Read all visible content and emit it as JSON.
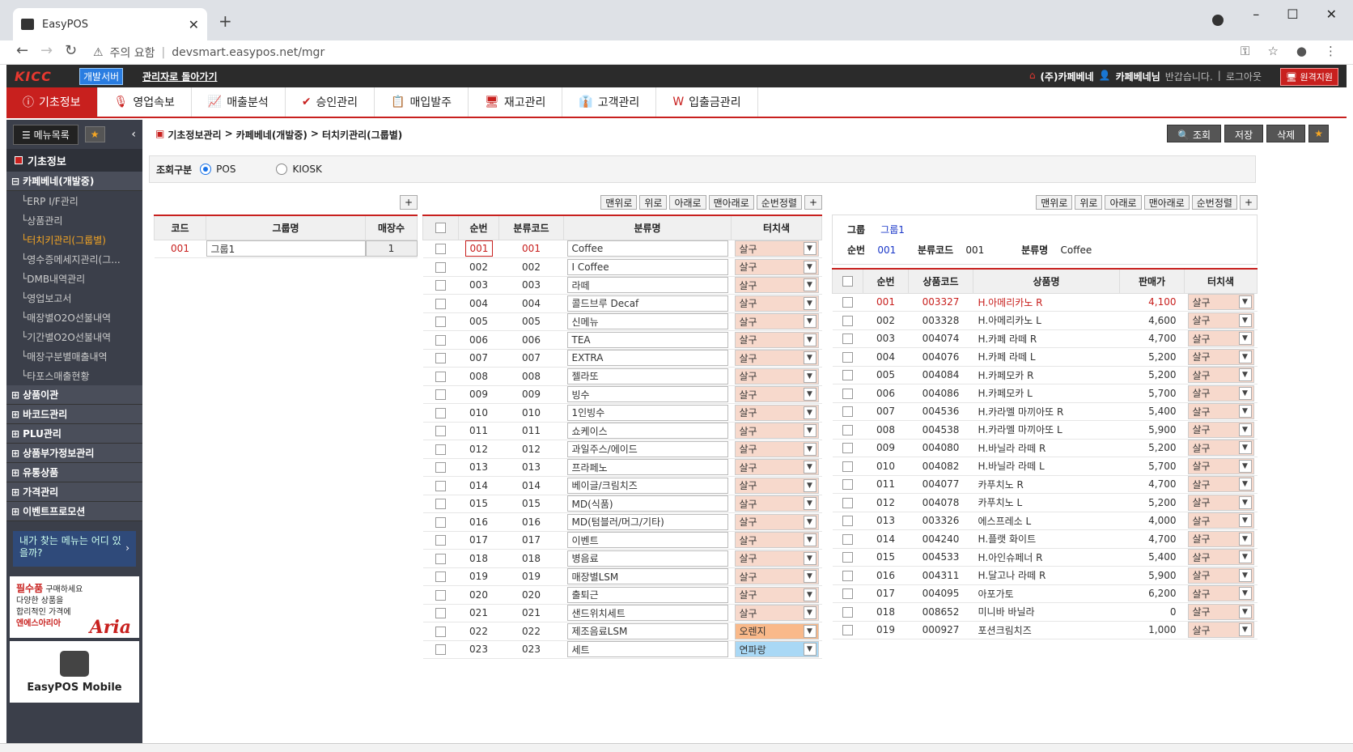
{
  "browser": {
    "tab_title": "EasyPOS",
    "warn": "주의 요함",
    "url": "devsmart.easypos.net/mgr"
  },
  "topbar": {
    "logo": "KICC",
    "dev": "개발서버",
    "back": "관리자로 돌아가기",
    "company": "(주)카페베네",
    "user": "카페베네님",
    "greet": "반갑습니다.",
    "logout": "로그아웃",
    "remote": "원격지원"
  },
  "menu": [
    {
      "label": "기초정보",
      "icon": "ⓘ",
      "active": true
    },
    {
      "label": "영업속보",
      "icon": "🎙"
    },
    {
      "label": "매출분석",
      "icon": "📈"
    },
    {
      "label": "승인관리",
      "icon": "✔"
    },
    {
      "label": "매입발주",
      "icon": "📋"
    },
    {
      "label": "재고관리",
      "icon": "🖥"
    },
    {
      "label": "고객관리",
      "icon": "👔"
    },
    {
      "label": "입출금관리",
      "icon": "W"
    }
  ],
  "sidebar": {
    "menu_btn": "메뉴목록",
    "header": "기초정보",
    "current_group": "카페베네(개발중)",
    "subs": [
      "ERP I/F관리",
      "상품관리",
      "터치키관리(그룹별)",
      "영수증메세지관리(그...",
      "DMB내역관리",
      "영업보고서",
      "매장별O2O선불내역",
      "기간별O2O선불내역",
      "매장구분별매출내역",
      "타포스매출현황"
    ],
    "groups": [
      "상품이관",
      "바코드관리",
      "PLU관리",
      "상품부가정보관리",
      "유통상품",
      "가격관리",
      "이벤트프로모션"
    ],
    "help": "내가 찾는 메뉴는 어디 있을까?",
    "ad_title": "필수품",
    "ad_rest": "구매하세요",
    "ad_l2": "다양한 상품을",
    "ad_l3": "합리적인 가격에",
    "ad_l4": "엔에스아리아",
    "ad_brand": "Aria",
    "mobile": "EasyPOS Mobile"
  },
  "breadcrumb": [
    "기초정보관리",
    "카페베네(개발중)",
    "터치키관리(그룹별)"
  ],
  "buttons": {
    "search": "조회",
    "save": "저장",
    "delete": "삭제",
    "top": "맨위로",
    "up": "위로",
    "down": "아래로",
    "bottom": "맨아래로",
    "sort": "순번정렬",
    "add": "+"
  },
  "filter": {
    "label": "조회구분",
    "opt1": "POS",
    "opt2": "KIOSK"
  },
  "group_table": {
    "headers": [
      "코드",
      "그룹명",
      "매장수"
    ],
    "rows": [
      {
        "code": "001",
        "name": "그룹1",
        "cnt": "1"
      }
    ]
  },
  "cat_table": {
    "headers": [
      "순번",
      "분류코드",
      "분류명",
      "터치색"
    ],
    "rows": [
      [
        "001",
        "001",
        "Coffee",
        "살구"
      ],
      [
        "002",
        "002",
        "I Coffee",
        "살구"
      ],
      [
        "003",
        "003",
        "라떼",
        "살구"
      ],
      [
        "004",
        "004",
        "콜드브루 Decaf",
        "살구"
      ],
      [
        "005",
        "005",
        "신메뉴",
        "살구"
      ],
      [
        "006",
        "006",
        "TEA",
        "살구"
      ],
      [
        "007",
        "007",
        "EXTRA",
        "살구"
      ],
      [
        "008",
        "008",
        "젤라또",
        "살구"
      ],
      [
        "009",
        "009",
        "빙수",
        "살구"
      ],
      [
        "010",
        "010",
        "1인빙수",
        "살구"
      ],
      [
        "011",
        "011",
        "쇼케이스",
        "살구"
      ],
      [
        "012",
        "012",
        "과일주스/에이드",
        "살구"
      ],
      [
        "013",
        "013",
        "프라페노",
        "살구"
      ],
      [
        "014",
        "014",
        "베이글/크림치즈",
        "살구"
      ],
      [
        "015",
        "015",
        "MD(식품)",
        "살구"
      ],
      [
        "016",
        "016",
        "MD(텀블러/머그/기타)",
        "살구"
      ],
      [
        "017",
        "017",
        "이벤트",
        "살구"
      ],
      [
        "018",
        "018",
        "병음료",
        "살구"
      ],
      [
        "019",
        "019",
        "매장별LSM",
        "살구"
      ],
      [
        "020",
        "020",
        "출퇴근",
        "살구"
      ],
      [
        "021",
        "021",
        "샌드위치세트",
        "살구"
      ],
      [
        "022",
        "022",
        "제조음료LSM",
        "오렌지"
      ],
      [
        "023",
        "023",
        "세트",
        "연파랑"
      ]
    ]
  },
  "detail": {
    "group_lbl": "그룹",
    "group_val": "그룹1",
    "seq_lbl": "순번",
    "seq_val": "001",
    "code_lbl": "분류코드",
    "code_val": "001",
    "name_lbl": "분류명",
    "name_val": "Coffee"
  },
  "prod_table": {
    "headers": [
      "순번",
      "상품코드",
      "상품명",
      "판매가",
      "터치색"
    ],
    "rows": [
      [
        "001",
        "003327",
        "H.아메리카노 R",
        "4,100",
        "살구"
      ],
      [
        "002",
        "003328",
        "H.아메리카노 L",
        "4,600",
        "살구"
      ],
      [
        "003",
        "004074",
        "H.카페 라떼 R",
        "4,700",
        "살구"
      ],
      [
        "004",
        "004076",
        "H.카페 라떼 L",
        "5,200",
        "살구"
      ],
      [
        "005",
        "004084",
        "H.카페모카 R",
        "5,200",
        "살구"
      ],
      [
        "006",
        "004086",
        "H.카페모카 L",
        "5,700",
        "살구"
      ],
      [
        "007",
        "004536",
        "H.카라멜 마끼아또 R",
        "5,400",
        "살구"
      ],
      [
        "008",
        "004538",
        "H.카라멜 마끼아또 L",
        "5,900",
        "살구"
      ],
      [
        "009",
        "004080",
        "H.바닐라 라떼 R",
        "5,200",
        "살구"
      ],
      [
        "010",
        "004082",
        "H.바닐라 라떼 L",
        "5,700",
        "살구"
      ],
      [
        "011",
        "004077",
        "카푸치노 R",
        "4,700",
        "살구"
      ],
      [
        "012",
        "004078",
        "카푸치노 L",
        "5,200",
        "살구"
      ],
      [
        "013",
        "003326",
        "에스프레소 L",
        "4,000",
        "살구"
      ],
      [
        "014",
        "004240",
        "H.플랫 화이트",
        "4,700",
        "살구"
      ],
      [
        "015",
        "004533",
        "H.아인슈페너 R",
        "5,400",
        "살구"
      ],
      [
        "016",
        "004311",
        "H.달고나 라떼 R",
        "5,900",
        "살구"
      ],
      [
        "017",
        "004095",
        "아포가토",
        "6,200",
        "살구"
      ],
      [
        "018",
        "008652",
        "미니바 바닐라",
        "0",
        "살구"
      ],
      [
        "019",
        "000927",
        "포션크림치즈",
        "1,000",
        "살구"
      ]
    ]
  },
  "colors": {
    "accent": "#c8201e",
    "apricot": "#f7d9cc",
    "orange": "#f9b98a",
    "lightblue": "#a9d8f5"
  }
}
